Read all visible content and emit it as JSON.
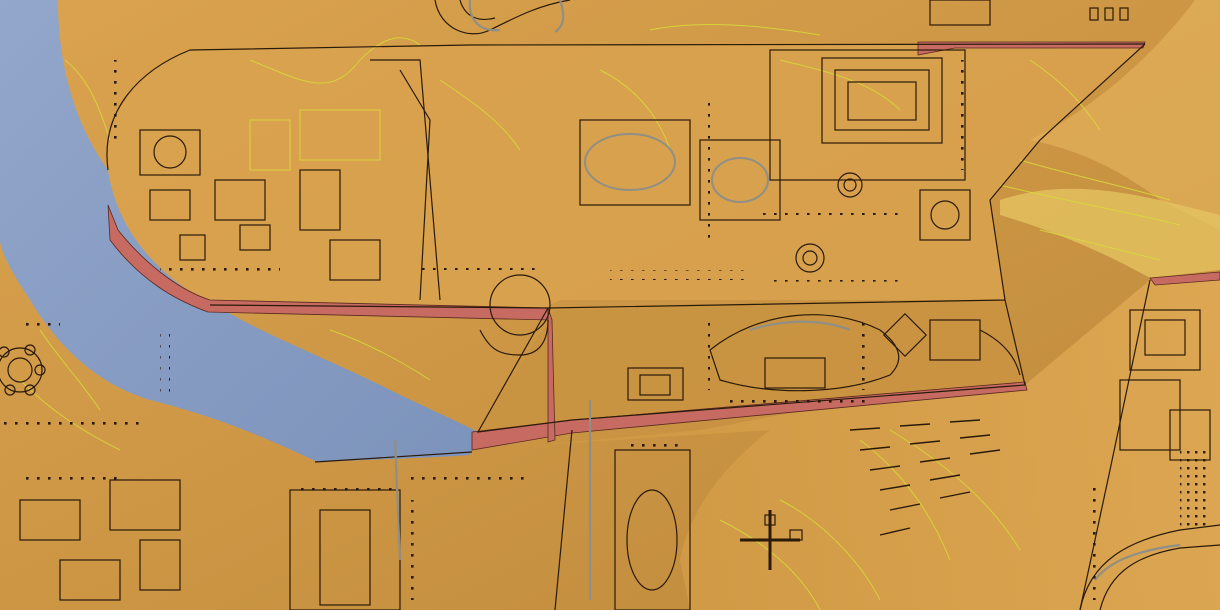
{
  "view": {
    "type": "3D terrain model with ancient city plan overlay",
    "colors": {
      "terrain_light": "#dfa54f",
      "terrain_dark": "#bb8838",
      "river_light": "#8fa2c7",
      "river_dark": "#7f95bd",
      "cut_face": "#c66a62",
      "contour_line": "#d7dc38",
      "plan_line": "#2a1a0a",
      "grey_feature": "#8f8f86"
    }
  },
  "layers": [
    {
      "name": "river",
      "icon": "water-icon"
    },
    {
      "name": "terrain-plateaus",
      "icon": "terrain-icon"
    },
    {
      "name": "contour-lines",
      "icon": "contour-icon"
    },
    {
      "name": "building-footprints",
      "icon": "building-icon"
    },
    {
      "name": "colonnades",
      "icon": "column-icon"
    }
  ]
}
